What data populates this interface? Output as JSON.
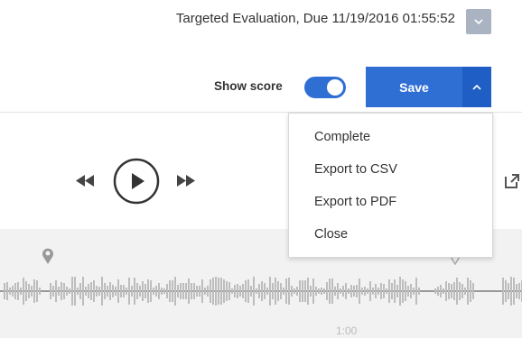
{
  "header": {
    "title": "Targeted Evaluation, Due 11/19/2016 01:55:52"
  },
  "toolbar": {
    "show_score_label": "Show score",
    "show_score_on": true,
    "save_label": "Save"
  },
  "save_menu": {
    "items": [
      {
        "label": "Complete"
      },
      {
        "label": "Export to CSV"
      },
      {
        "label": "Export to PDF"
      },
      {
        "label": "Close"
      }
    ]
  },
  "playback": {
    "time_label": "1:00"
  },
  "icons": {
    "header_dropdown": "chevron-down-icon",
    "save_caret": "chevron-up-icon",
    "rewind": "rewind-icon",
    "play": "play-icon",
    "fast_forward": "fast-forward-icon",
    "external": "external-link-icon",
    "marker_left": "marker-pin-icon",
    "marker_right": "marker-pin-icon"
  },
  "colors": {
    "accent": "#2f6fd4",
    "accent_dark": "#1f5ec4",
    "dropdown_gray": "#a9b3c1",
    "waveform": "#bdbdbd"
  }
}
